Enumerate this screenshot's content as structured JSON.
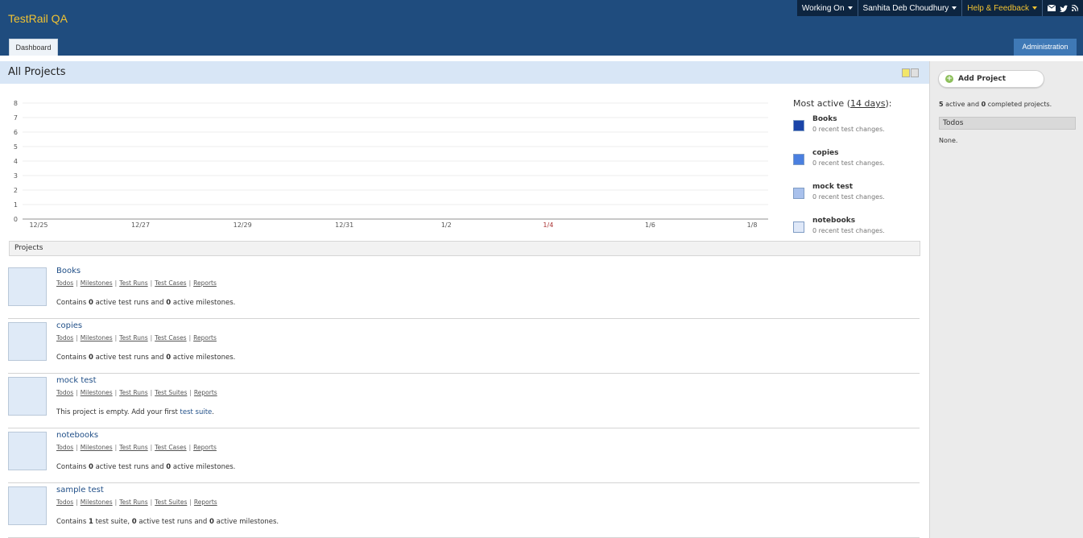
{
  "app_title": "TestRail QA",
  "topbar": {
    "working_on": "Working On",
    "user": "Sanhita Deb Choudhury",
    "help": "Help & Feedback"
  },
  "tabs": {
    "dashboard": "Dashboard",
    "administration": "Administration"
  },
  "page_title": "All Projects",
  "sidebar": {
    "add_project": "Add Project",
    "summary_active_count": "5",
    "summary_mid": " active and ",
    "summary_completed_count": "0",
    "summary_end": " completed projects.",
    "todos_heading": "Todos",
    "todos_value": "None."
  },
  "legend": {
    "title_prefix": "Most active (",
    "title_link": "14 days",
    "title_suffix": "):",
    "items": [
      {
        "name": "Books",
        "sub": "0 recent test changes.",
        "color": "#1a44a8"
      },
      {
        "name": "copies",
        "sub": "0 recent test changes.",
        "color": "#4a7fe0"
      },
      {
        "name": "mock test",
        "sub": "0 recent test changes.",
        "color": "#a9c1ec"
      },
      {
        "name": "notebooks",
        "sub": "0 recent test changes.",
        "color": "#dfe8f8"
      }
    ]
  },
  "chart_data": {
    "type": "line",
    "x": [
      "12/25",
      "12/27",
      "12/29",
      "12/31",
      "1/2",
      "1/4",
      "1/6",
      "1/8"
    ],
    "ylim": [
      0,
      8
    ],
    "yticks": [
      "0",
      "1",
      "2",
      "3",
      "4",
      "5",
      "6",
      "7",
      "8"
    ],
    "grid": true,
    "series": [
      {
        "name": "Books",
        "values": [
          0,
          0,
          0,
          0,
          0,
          0,
          0,
          0
        ]
      },
      {
        "name": "copies",
        "values": [
          0,
          0,
          0,
          0,
          0,
          0,
          0,
          0
        ]
      },
      {
        "name": "mock test",
        "values": [
          0,
          0,
          0,
          0,
          0,
          0,
          0,
          0
        ]
      },
      {
        "name": "notebooks",
        "values": [
          0,
          0,
          0,
          0,
          0,
          0,
          0,
          0
        ]
      }
    ]
  },
  "projects_heading": "Projects",
  "link_sep": "|",
  "projects": [
    {
      "name": "Books",
      "links": [
        "Todos",
        "Milestones",
        "Test Runs",
        "Test Cases",
        "Reports"
      ],
      "d1": "Contains ",
      "d2": "0",
      "d3": " active test runs and ",
      "d4": "0",
      "d5": " active milestones."
    },
    {
      "name": "copies",
      "links": [
        "Todos",
        "Milestones",
        "Test Runs",
        "Test Cases",
        "Reports"
      ],
      "d1": "Contains ",
      "d2": "0",
      "d3": " active test runs and ",
      "d4": "0",
      "d5": " active milestones."
    },
    {
      "name": "mock test",
      "links": [
        "Todos",
        "Milestones",
        "Test Runs",
        "Test Suites",
        "Reports"
      ],
      "empty_text": "This project is empty. Add your first ",
      "empty_link": "test suite",
      "empty_end": "."
    },
    {
      "name": "notebooks",
      "links": [
        "Todos",
        "Milestones",
        "Test Runs",
        "Test Cases",
        "Reports"
      ],
      "d1": "Contains ",
      "d2": "0",
      "d3": " active test runs and ",
      "d4": "0",
      "d5": " active milestones."
    },
    {
      "name": "sample test",
      "links": [
        "Todos",
        "Milestones",
        "Test Runs",
        "Test Suites",
        "Reports"
      ],
      "s1": "Contains ",
      "s2": "1",
      "s3": " test suite, ",
      "s4": "0",
      "s5": " active test runs and ",
      "s6": "0",
      "s7": " active milestones."
    }
  ]
}
